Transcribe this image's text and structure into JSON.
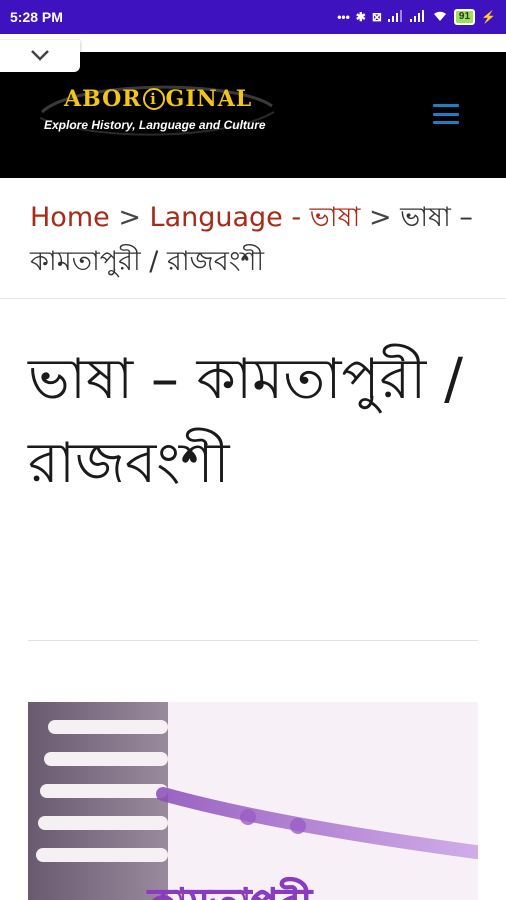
{
  "status_bar": {
    "time": "5:28 PM",
    "icons": [
      "more-dots-icon",
      "bluetooth-icon",
      "volte-icon",
      "signal-icon",
      "signal-icon",
      "wifi-icon",
      "battery-icon",
      "charging-icon"
    ],
    "dots": "•••",
    "bluetooth": "✱",
    "volte": "⊠",
    "battery_level": "91",
    "charging": "⚡",
    "color": "#3f12bf"
  },
  "header": {
    "logo_title": "ABOR",
    "logo_title_i": "i",
    "logo_title_rest": "GINAL",
    "logo_tagline": "Explore History, Language and Culture",
    "menu_icon": "hamburger-menu-icon",
    "collapse_icon": "chevron-down-icon",
    "background": "#000000",
    "accent": "#f2c518",
    "menu_color": "#1e7fc4"
  },
  "breadcrumb": {
    "home": "Home",
    "sep1": " > ",
    "language": "Language - ভাষা",
    "sep2": " > ",
    "current": "ভাষা – কামতাপুরী / রাজবংশী",
    "link_color": "#a92a16"
  },
  "article": {
    "title": "ভাষা – কামতাপুরী / রাজবংশী",
    "featured_image_caption": "কামতাপুরী"
  }
}
